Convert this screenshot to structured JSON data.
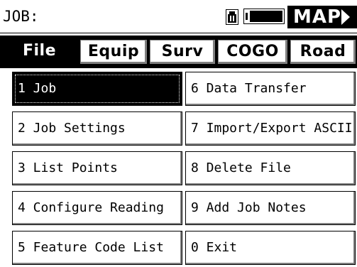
{
  "titlebar": {
    "title": "JOB:",
    "map_label": "MAP",
    "icons": {
      "battery": "battery-icon",
      "power": "power-level-icon",
      "map_arrow": "arrow-right-icon"
    }
  },
  "tabs": [
    {
      "label": "File",
      "active": true
    },
    {
      "label": "Equip",
      "active": false
    },
    {
      "label": "Surv",
      "active": false
    },
    {
      "label": "COGO",
      "active": false
    },
    {
      "label": "Road",
      "active": false
    }
  ],
  "menu": {
    "left": [
      {
        "label": "1 Job",
        "selected": true
      },
      {
        "label": "2 Job Settings"
      },
      {
        "label": "3 List Points"
      },
      {
        "label": "4 Configure Reading"
      },
      {
        "label": "5 Feature Code List"
      }
    ],
    "right": [
      {
        "label": "6 Data Transfer"
      },
      {
        "label": "7 Import/Export ASCII"
      },
      {
        "label": "8 Delete File"
      },
      {
        "label": "9 Add Job Notes"
      },
      {
        "label": "0 Exit"
      }
    ]
  },
  "colors": {
    "background": "#ffffff",
    "foreground": "#000000",
    "bevel_shadow": "#808080"
  }
}
